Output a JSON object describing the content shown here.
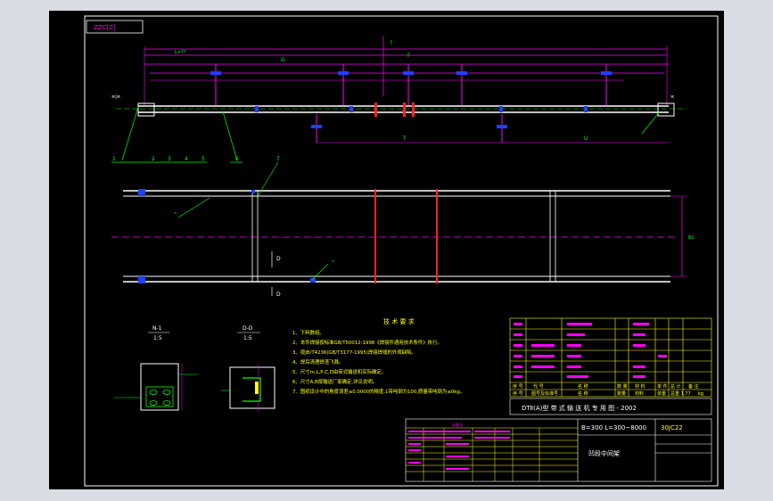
{
  "colors": {
    "background": "#d9dde3",
    "sheet": "#000000",
    "frame": "#ffffff",
    "green": "#00ff00",
    "magenta": "#ff00ff",
    "yellow": "#ffff00",
    "blue": "#2040ff",
    "red": "#ff2020",
    "cyan": "#00ffff"
  },
  "drawing": {
    "revision_box": "ZZC[Z]"
  },
  "views": {
    "top": {
      "dims": [
        "L=??",
        "G",
        "?",
        "F",
        "T",
        "U"
      ],
      "leaders": [
        "1",
        "2",
        "3",
        "4",
        "5",
        "6",
        "7"
      ]
    },
    "plan": {
      "section_mark": "D",
      "side_dim": "B1",
      "leader_texts": [
        "≡",
        "≡"
      ]
    },
    "detail_1": {
      "label": "N-1",
      "scale": "1:5"
    },
    "detail_2": {
      "label": "D-D",
      "scale": "1:5"
    }
  },
  "technical_requirements": {
    "title": "技 术 要 求",
    "items": [
      "1、下料数组。",
      "2、本件焊接按标准GB/T50012-1998《焊接件通用技术条件》执行。",
      "3、按JB/T4236(GB/T3177-1995)焊接焊缝的外观缺陷。",
      "4、焊后清理焊渣飞溅。",
      "5、尺寸m,L,P,C,D由带式输送机实际确定。",
      "6、尺寸A,B按输送厂家确定,详见说明。",
      "7、图纸设计中的角度误差≤0.0000的精度,1带吨钢为100,质量带吨钢为≤0kg。"
    ]
  },
  "bom": {
    "rows": [
      [
        "",
        "",
        "",
        "",
        "",
        "",
        "",
        ""
      ],
      [
        "",
        "",
        "",
        "",
        "",
        "",
        "",
        ""
      ],
      [
        "",
        "",
        "",
        "",
        "",
        "",
        "",
        ""
      ],
      [
        "",
        "",
        "",
        "",
        "",
        "",
        "",
        ""
      ],
      [
        "",
        "",
        "",
        "",
        "",
        "",
        "",
        ""
      ],
      [
        "",
        "",
        "",
        "",
        "",
        "",
        "",
        ""
      ],
      [
        "",
        "",
        "",
        "",
        "",
        "",
        "",
        ""
      ]
    ],
    "header": [
      "序 号",
      "代 号",
      "名 称",
      "数 量",
      "材 料",
      "单 件",
      "总 计",
      "备 注"
    ],
    "header_sub": [
      "序 号",
      "图号及标准号",
      "名 称",
      "数量",
      "材料",
      "单重",
      "总重 1.77",
      "kg"
    ]
  },
  "title_block": {
    "project": "DTⅡ(A)型 带 式 输 送 机 专 用 图 - 2002",
    "spec": "B=300 L=300~8000",
    "code": "30JC22",
    "drawing_name": "凹段中间架",
    "notes_header": "标准化"
  }
}
